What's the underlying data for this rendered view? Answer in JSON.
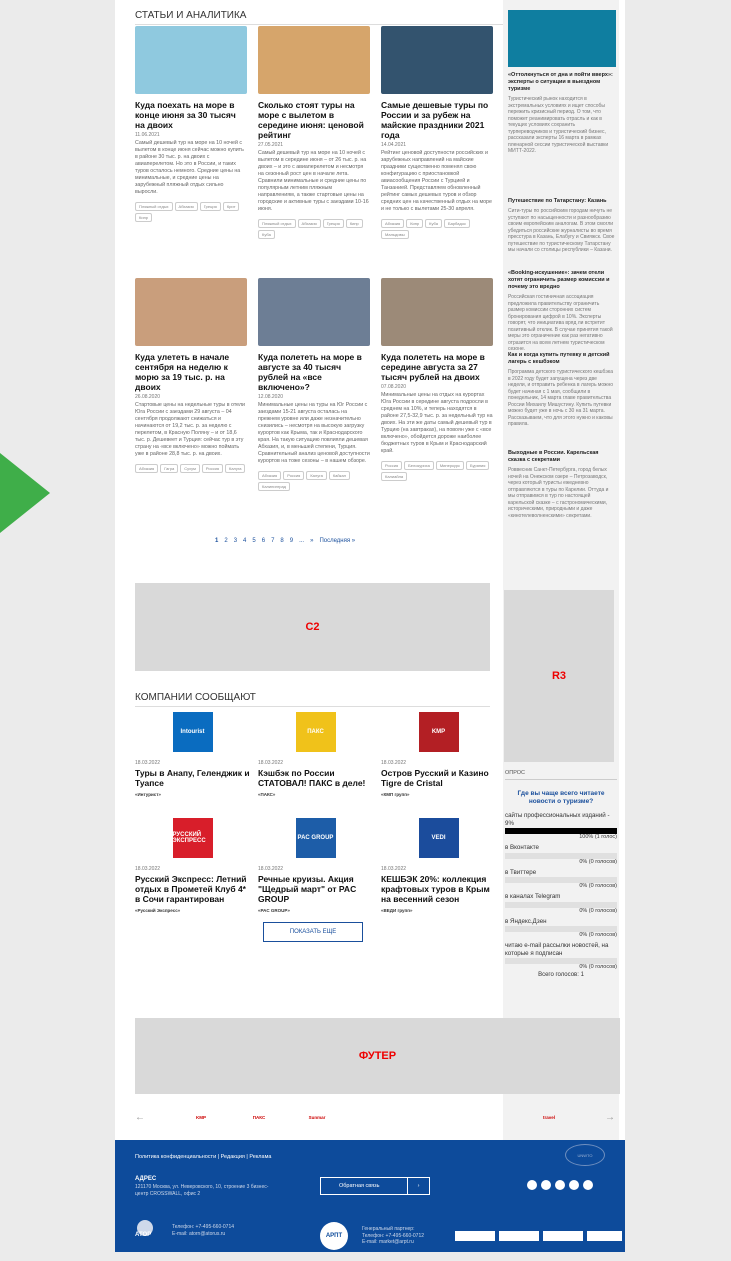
{
  "section_title": "СТАТЬИ И АНАЛИТИКА",
  "articles": [
    {
      "title": "Куда поехать на море в конце июня за 30 тысяч на двоих",
      "date": "11.06.2021",
      "text": "Самый дешевый тур на море на 10 ночей с вылетом в конце июня сейчас можно купить в районе 30 тыс. р. на двоих с авиаперелетом. Но это в России, и таких туров осталось немного. Средние цены на минимальные, и средние цены на зарубежный пляжный отдых сильно выросли.",
      "tags": [
        "Пляжный отдых",
        "Абхазия",
        "Греция",
        "Крит",
        "Кипр"
      ],
      "color": "#8fc9df"
    },
    {
      "title": "Сколько стоят туры на море с вылетом в середине июня: ценовой рейтинг",
      "date": "27.05.2021",
      "text": "Самый дешевый тур на море на 10 ночей с вылетом в середине июня – от 26 тыс. р. на двоих – и это с авиаперелетом и несмотря на сезонный рост цен в начале лета. Сравнили минимальные и средние цены по популярным летним пляжным направлениям, а также стартовые цены на городские и активные туры с заездами 10-16 июня.",
      "tags": [
        "Пляжный отдых",
        "Абхазия",
        "Греция",
        "Кипр",
        "Куба"
      ],
      "color": "#d6a56b"
    },
    {
      "title": "Самые дешевые туры по России и за рубеж на майские праздники 2021 года",
      "date": "14.04.2021",
      "text": "Рейтинг ценовой доступности российских и зарубежных направлений на майские праздники существенно поменял свою конфигурацию с приостановкой авиасообщения России с Турцией и Танзанией. Представляем обновленный рейтинг самых дешевых туров и обзор средних цен на качественный отдых на море и не только с вылетами 25-30 апреля.",
      "tags": [
        "Абхазия",
        "Кипр",
        "Куба",
        "Барбадос",
        "Мальдивы"
      ],
      "color": "#33536e"
    },
    {
      "title": "Куда улететь в начале сентября на неделю к морю за 19 тыс. р. на двоих",
      "date": "26.08.2020",
      "text": "Стартовые цены на недельные туры в отели Юга России с заездами 29 августа – 04 сентября продолжают снижаться и начинаются от 19,2 тыс. р. за неделю с перелетом, в Красную Поляну – и от 18,6 тыс. р. Дешевеет и Турция: сейчас тур в эту страну на «все включено» можно поймать уже в районе 28,8 тыс. р. на двоих.",
      "tags": [
        "Абхазия",
        "Гагра",
        "Сухум",
        "Россия",
        "Калуга"
      ],
      "color": "#c99e7c"
    },
    {
      "title": "Куда полететь на море в августе за 40 тысяч рублей на «все включено»?",
      "date": "12.08.2020",
      "text": "Минимальные цены на туры на Юг России с заездами 15-21 августа осталась на прежнем уровне или даже незначительно снизились – несмотря на высокую загрузку курортов как Крыма, так и Краснодарского края. На такую ситуацию повлияли дешевая Абхазия, и, в меньшей степени, Турция. Сравнительный анализ ценовой доступности курортов на тоже сезоны – в нашем обзоре.",
      "tags": [
        "Абхазия",
        "Россия",
        "Калуга",
        "Кайкал",
        "Калининград"
      ],
      "color": "#6d7e95"
    },
    {
      "title": "Куда полететь на море в середине августа за 27 тысяч рублей на двоих",
      "date": "07.08.2020",
      "text": "Минимальные цены на отдых на курортах Юга России в середине августа подросли в среднем на 10%, и теперь находятся в районе 27,5-32,9 тыс. р. за недельный тур на двоих. На эти же даты самый дешевый тур в Турцию (на завтраках), на повоян уже с «все включено», обойдется дороже наиболее бюджетных туров в Крым и Краснодарский край.",
      "tags": [
        "Россия",
        "Белокуриха",
        "Минеркурс",
        "Буряпия",
        "Калиайла"
      ],
      "color": "#9c8a78"
    }
  ],
  "pager": {
    "pages": [
      "1",
      "2",
      "3",
      "4",
      "5",
      "6",
      "7",
      "8",
      "9",
      "...",
      "»",
      "Последняя »"
    ]
  },
  "placeholders": {
    "c2": "C2",
    "r3": "R3",
    "footer": "ФУТЕР"
  },
  "companies_title": "КОМПАНИИ СООБЩАЮТ",
  "companies": [
    {
      "date": "18.03.2022",
      "title": "Туры в Анапу, Геленджик и Туапсе",
      "source": "«Интурист»",
      "logo": "Intourist",
      "color": "#0a6cc0"
    },
    {
      "date": "18.03.2022",
      "title": "Кэшбэк по России СТАТОВАЛ! ПАКС в деле!",
      "source": "«ПАКС»",
      "logo": "ПАКС",
      "color": "#f0c21a"
    },
    {
      "date": "18.03.2022",
      "title": "Остров Русский и Казино Tigre de Cristal",
      "source": "«КМП групп»",
      "logo": "KMP",
      "color": "#b31f24"
    },
    {
      "date": "18.03.2022",
      "title": "Русский Экспресс: Летний отдых в Прометей Клуб 4* в Сочи гарантирован",
      "source": "«Русский Экспресс»",
      "logo": "РУССКИЙ ЭКСПРЕСС",
      "color": "#d81e2a"
    },
    {
      "date": "18.03.2022",
      "title": "Речные круизы. Акция \"Щедрый март\" от PAC GROUP",
      "source": "«PAC GROUP»",
      "logo": "PAC GROUP",
      "color": "#1d5da8"
    },
    {
      "date": "18.03.2022",
      "title": "КЕШБЭК 20%: коллекция крафтовых туров в Крым на весенний сезон",
      "source": "«ВЕДИ групп»",
      "logo": "VEDI",
      "color": "#1b4c9c"
    }
  ],
  "more_button": "ПОКАЗАТЬ ЕЩЕ",
  "sidebar": [
    {
      "title": "«Оттолкнуться от дна и пойти вверх»: эксперты о ситуации в выездном туризме",
      "text": "Туристический рынок находится в экстремальных условиях и ищет способы пережить кризисный период. О том, что поможет реанимировать отрасль и как в текущих условиях сохранить турпереводчиков и туристический бизнес, рассказали эксперты 16 марта в рамках пленарной сессии туристической выставки МИТТ-2022."
    },
    {
      "title": "Путешествие по Татарстану: Казань",
      "text": "Сити-туры по российским городам ничуть не уступают по насыщенности и разнообразию своим европейским аналогам. В этом смогли убедиться российские журналисты во время пресстура в Казань, Елабугу и Свияжск. Свое путешествие по туристическому Татарстану мы начали со столицы республики – Казани."
    },
    {
      "title": "«Booking-искушение»: зачем отели хотят ограничить размер комиссии и почему это вредно",
      "text": "Российская гостиничная ассоциация предложила правительству ограничить размер комиссии сторонних систем бронирования цифрой в 10%. Эксперты говорят, что инициатива вряд ли встретит позитивный отклик. В случае принятия такой меры это ограничение как раз негативно отразится на всем летнем туристическом сезоне."
    },
    {
      "title": "Как и когда купить путевку в детский лагерь с кешбэком",
      "text": "Программа детского туристического кешбэка в 2022 году будет запущена через две недели, и отправить ребенка в лагерь можно будет начиная с 1 мая, сообщили в понедельник, 14 марта главе правительства России Михаилу Мишустину. Купить путевки можно будет уже в ночь с 30 на 31 марта. Рассказываем, что для этого нужно и каковы правила."
    },
    {
      "title": "Выходные в России. Карельская сказка с секретами",
      "text": "Роввесник Санкт-Петербурга, город белых ночей на Онежском озере – Петрозаводск, через который туристы ежедневно отправляются в туры по Карелии. Оттуда и мы отправимся в тур по настоящей карельской сказке – с гастрономическими, историческими, природными и даже «кинотелеволненскими» секретами."
    }
  ],
  "poll": {
    "title": "ОПРОС",
    "question": "Где вы чаще всего читаете новости о туризме?",
    "options": [
      {
        "label": "сайты профессиональных изданий - 9%",
        "result": "100% (1 голос)",
        "value": 1.0
      },
      {
        "label": "в Вконтакте",
        "result": "0% (0 голосов)",
        "value": 0
      },
      {
        "label": "в Твиттере",
        "result": "0% (0 голосов)",
        "value": 0
      },
      {
        "label": "в каналах Telegram",
        "result": "0% (0 голосов)",
        "value": 0
      },
      {
        "label": "в Яндекс.Дзен",
        "result": "0% (0 голосов)",
        "value": 0
      },
      {
        "label": "читаю e-mail рассылки новостей, на которые я подписан",
        "result": "0% (0 голосов)",
        "value": 0
      }
    ],
    "total": "Всего голосов: 1"
  },
  "partners": [
    "KMP",
    "ПАКС",
    "Sunmar",
    "",
    "",
    "",
    "travel"
  ],
  "footer": {
    "links": "Политика конфиденциальности  |  Редакция  |  Реклама",
    "addr_title": "АДРЕС",
    "addr": "121170 Москва, ул. Неверовского, 10, строение 3 бизнес-центр CROSSWALL, офис 2",
    "feedback": "Обратная связь",
    "phone": "Телефон: +7-495-660-0714",
    "email": "E-mail: atorn@atorus.ru",
    "atop": "АТОР",
    "arpt": "АРПТ",
    "gen_title": "Генеральный партнер:",
    "gen_phone": "Телефон: +7-495-660-0712",
    "gen_email": "E-mail: market@arpt.ru",
    "unwto": "UNWTO"
  }
}
